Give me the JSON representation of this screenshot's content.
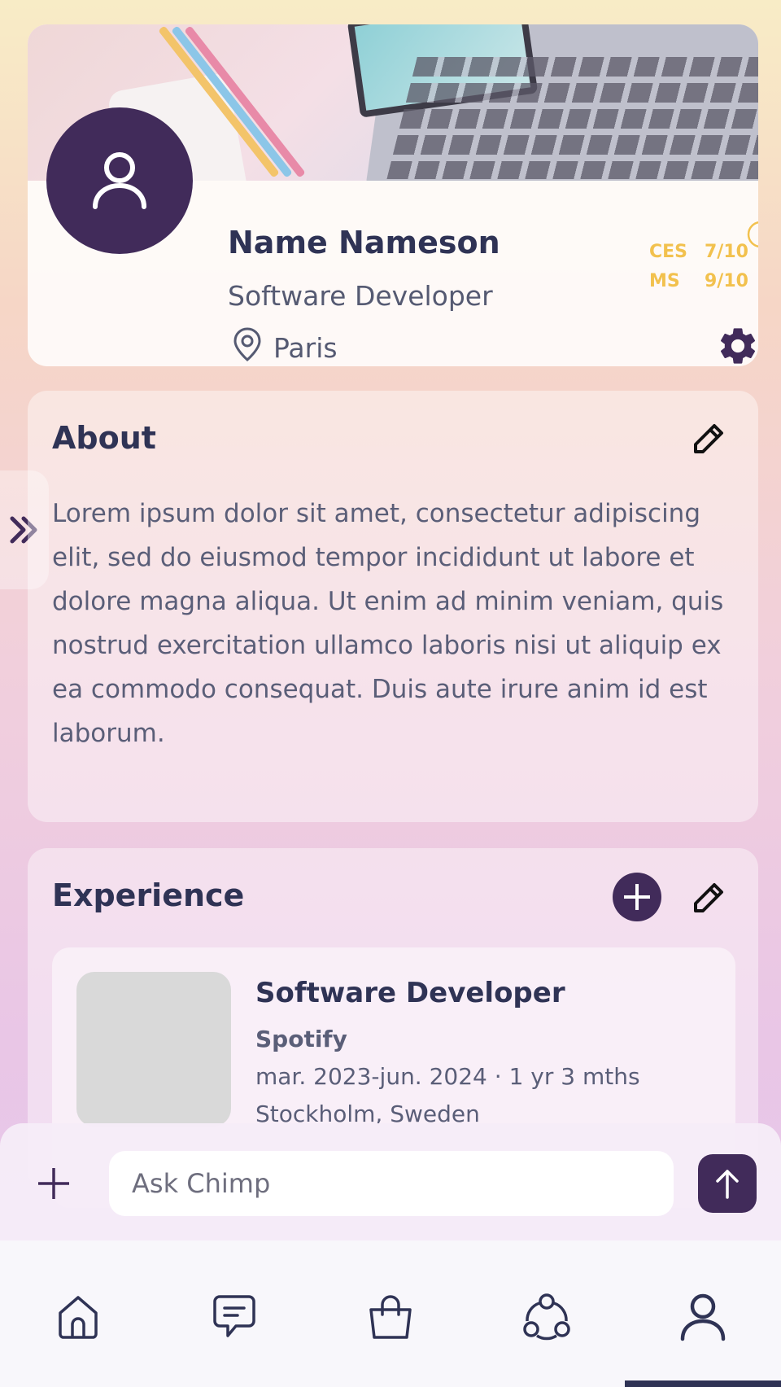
{
  "profile": {
    "name": "Name Nameson",
    "title": "Software Developer",
    "location": "Paris",
    "scores": [
      {
        "label": "CES",
        "value": "7/10"
      },
      {
        "label": "MS",
        "value": "9/10"
      }
    ]
  },
  "about": {
    "heading": "About",
    "text": "Lorem ipsum dolor sit amet, consectetur adipiscing elit, sed do eiusmod tempor incididunt ut labore et dolore magna aliqua. Ut enim ad minim veniam, quis nostrud exercitation ullamco laboris nisi ut aliquip ex ea commodo consequat. Duis aute irure anim id est laborum."
  },
  "experience": {
    "heading": "Experience",
    "items": [
      {
        "role": "Software Developer",
        "company": "Spotify",
        "dates": "mar. 2023-jun. 2024 · 1 yr 3 mths",
        "place": "Stockholm, Sweden"
      }
    ]
  },
  "chat": {
    "placeholder": "Ask Chimp"
  },
  "nav": {
    "items": [
      "home-icon",
      "chat-icon",
      "shop-icon",
      "community-icon",
      "profile-icon"
    ],
    "active": "profile-icon"
  },
  "colors": {
    "primary": "#412b5a",
    "text": "#2f3355",
    "score": "#f2c14e"
  }
}
